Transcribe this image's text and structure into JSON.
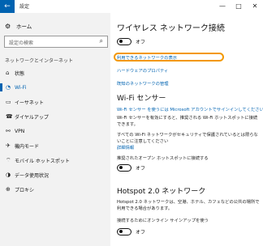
{
  "window": {
    "back_glyph": "←",
    "title": "設定",
    "controls": [
      "—",
      "□",
      "✕"
    ]
  },
  "nav": {
    "home_label": "ホーム",
    "search_placeholder": "設定の検索",
    "section_label": "ネットワークとインターネット",
    "items": [
      {
        "label": "状態",
        "icon": "status-icon"
      },
      {
        "label": "Wi-Fi",
        "icon": "wifi-icon"
      },
      {
        "label": "イーサネット",
        "icon": "ethernet-icon"
      },
      {
        "label": "ダイヤルアップ",
        "icon": "dialup-icon"
      },
      {
        "label": "VPN",
        "icon": "vpn-icon"
      },
      {
        "label": "機内モード",
        "icon": "airplane-icon"
      },
      {
        "label": "モバイル ホットスポット",
        "icon": "hotspot-icon"
      },
      {
        "label": "データ使用状況",
        "icon": "data-usage-icon"
      },
      {
        "label": "プロキシ",
        "icon": "proxy-icon"
      }
    ],
    "active_index": 1
  },
  "main": {
    "title": "ワイヤレス ネットワーク接続",
    "wifi_toggle_label": "オフ",
    "show_networks_link": "利用できるネットワークの表示",
    "hardware_link": "ハードウェアのプロパティ",
    "manage_known_link": "既知のネットワークの管理",
    "sense_title": "Wi-Fi センサー",
    "sense_link": "Wi-Fi センサー を使うには Microsoft アカウントでサインインしてください",
    "sense_desc": "Wi-Fi センサーを有効にすると、推奨される Wi-Fi ホットスポットに接続できます。",
    "caution_desc": "すべての Wi-Fi ネットワークがセキュリティで保護されているとは限らないことに注意してください",
    "details_link": "詳細情報",
    "open_hotspot_label": "推奨されたオープン ホットスポットに接続する",
    "open_hotspot_toggle": "オフ",
    "hotspot20_title": "Hotspot 2.0 ネットワーク",
    "hotspot20_desc": "Hotspot 2.0 ネットワークは、空港、ホテル、カフェなどの公共の場所で利用できる場合があります。",
    "online_signup_label": "接続するためにオンライン サインアップを使う",
    "online_signup_toggle": "オフ"
  },
  "colors": {
    "accent": "#0063b1",
    "highlight": "#f39800"
  }
}
